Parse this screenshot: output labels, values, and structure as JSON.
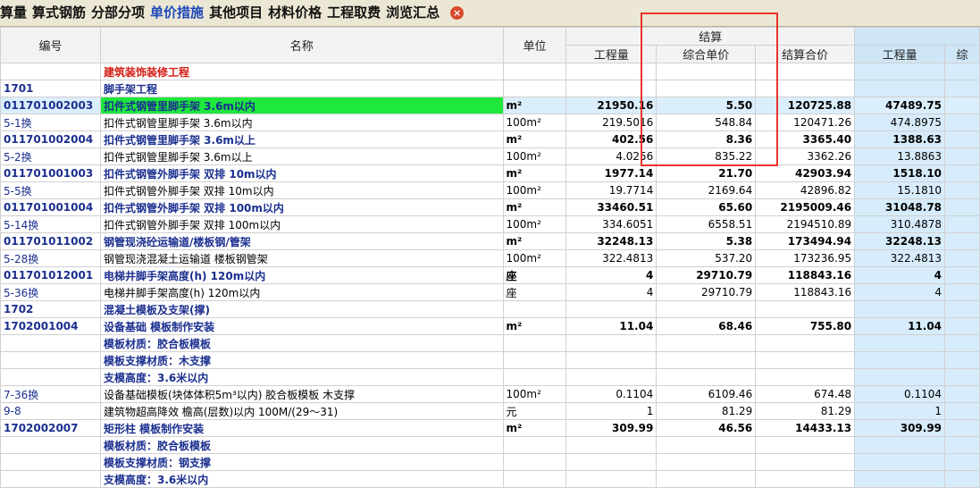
{
  "tabs": [
    {
      "label": "算量",
      "active": false
    },
    {
      "label": "算式钢筋",
      "active": false
    },
    {
      "label": "分部分项",
      "active": false
    },
    {
      "label": "单价措施",
      "active": true
    },
    {
      "label": "其他项目",
      "active": false
    },
    {
      "label": "材料价格",
      "active": false
    },
    {
      "label": "工程取费",
      "active": false
    },
    {
      "label": "浏览汇总",
      "active": false
    }
  ],
  "headers": {
    "code": "编号",
    "name": "名称",
    "unit": "单位",
    "group": "结算",
    "qty": "工程量",
    "unit_price": "综合单价",
    "total": "结算合价",
    "qty2": "工程量",
    "extra": "综"
  },
  "rows": [
    {
      "type": "cat1",
      "code": "",
      "name": "建筑装饰装修工程",
      "unit": "",
      "qty": "",
      "price": "",
      "total": "",
      "qty2": ""
    },
    {
      "type": "cat",
      "code": "1701",
      "name": "脚手架工程",
      "unit": "",
      "qty": "",
      "price": "",
      "total": "",
      "qty2": ""
    },
    {
      "type": "bold sel",
      "code": "011701002003",
      "name": "扣件式钢管里脚手架 3.6m以内",
      "unit": "m²",
      "qty": "21950.16",
      "price": "5.50",
      "total": "120725.88",
      "qty2": "47489.75"
    },
    {
      "type": "sub",
      "code": "5-1换",
      "name": "扣件式钢管里脚手架 3.6m以内",
      "unit": "100m²",
      "qty": "219.5016",
      "price": "548.84",
      "total": "120471.26",
      "qty2": "474.8975"
    },
    {
      "type": "bold",
      "code": "011701002004",
      "name": "扣件式钢管里脚手架 3.6m以上",
      "unit": "m²",
      "qty": "402.56",
      "price": "8.36",
      "total": "3365.40",
      "qty2": "1388.63"
    },
    {
      "type": "sub",
      "code": "5-2换",
      "name": "扣件式钢管里脚手架 3.6m以上",
      "unit": "100m²",
      "qty": "4.0256",
      "price": "835.22",
      "total": "3362.26",
      "qty2": "13.8863"
    },
    {
      "type": "bold",
      "code": "011701001003",
      "name": "扣件式钢管外脚手架 双排 10m以内",
      "unit": "m²",
      "qty": "1977.14",
      "price": "21.70",
      "total": "42903.94",
      "qty2": "1518.10"
    },
    {
      "type": "sub",
      "code": "5-5换",
      "name": "扣件式钢管外脚手架 双排 10m以内",
      "unit": "100m²",
      "qty": "19.7714",
      "price": "2169.64",
      "total": "42896.82",
      "qty2": "15.1810"
    },
    {
      "type": "bold",
      "code": "011701001004",
      "name": "扣件式钢管外脚手架 双排 100m以内",
      "unit": "m²",
      "qty": "33460.51",
      "price": "65.60",
      "total": "2195009.46",
      "qty2": "31048.78"
    },
    {
      "type": "sub",
      "code": "5-14换",
      "name": "扣件式钢管外脚手架 双排 100m以内",
      "unit": "100m²",
      "qty": "334.6051",
      "price": "6558.51",
      "total": "2194510.89",
      "qty2": "310.4878"
    },
    {
      "type": "bold",
      "code": "011701011002",
      "name": "钢管现浇砼运输道/楼板钢/管架",
      "unit": "m²",
      "qty": "32248.13",
      "price": "5.38",
      "total": "173494.94",
      "qty2": "32248.13"
    },
    {
      "type": "sub",
      "code": "5-28换",
      "name": "钢管现浇混凝土运输道 楼板钢管架",
      "unit": "100m²",
      "qty": "322.4813",
      "price": "537.20",
      "total": "173236.95",
      "qty2": "322.4813"
    },
    {
      "type": "bold",
      "code": "011701012001",
      "name": "电梯井脚手架高度(h) 120m以内",
      "unit": "座",
      "qty": "4",
      "price": "29710.79",
      "total": "118843.16",
      "qty2": "4"
    },
    {
      "type": "sub",
      "code": "5-36换",
      "name": "电梯井脚手架高度(h) 120m以内",
      "unit": "座",
      "qty": "4",
      "price": "29710.79",
      "total": "118843.16",
      "qty2": "4"
    },
    {
      "type": "cat",
      "code": "1702",
      "name": "混凝土模板及支架(撑)",
      "unit": "",
      "qty": "",
      "price": "",
      "total": "",
      "qty2": ""
    },
    {
      "type": "bold",
      "code": "1702001004",
      "name": "设备基础 模板制作安装",
      "unit": "m²",
      "qty": "11.04",
      "price": "68.46",
      "total": "755.80",
      "qty2": "11.04"
    },
    {
      "type": "feat",
      "code": "",
      "name": "模板材质：胶合板模板",
      "unit": "",
      "qty": "",
      "price": "",
      "total": "",
      "qty2": ""
    },
    {
      "type": "feat",
      "code": "",
      "name": "模板支撑材质：木支撑",
      "unit": "",
      "qty": "",
      "price": "",
      "total": "",
      "qty2": ""
    },
    {
      "type": "feat",
      "code": "",
      "name": "支模高度：3.6米以内",
      "unit": "",
      "qty": "",
      "price": "",
      "total": "",
      "qty2": ""
    },
    {
      "type": "sub",
      "code": "7-36换",
      "name": "设备基础模板(块体体积5m³以内) 胶合板模板 木支撑",
      "unit": "100m²",
      "qty": "0.1104",
      "price": "6109.46",
      "total": "674.48",
      "qty2": "0.1104"
    },
    {
      "type": "sub",
      "code": "9-8",
      "name": "建筑物超高降效 檐高(层数)以内 100M/(29～31)",
      "unit": "元",
      "qty": "1",
      "price": "81.29",
      "total": "81.29",
      "qty2": "1"
    },
    {
      "type": "bold",
      "code": "1702002007",
      "name": "矩形柱 模板制作安装",
      "unit": "m²",
      "qty": "309.99",
      "price": "46.56",
      "total": "14433.13",
      "qty2": "309.99"
    },
    {
      "type": "feat",
      "code": "",
      "name": "模板材质：胶合板模板",
      "unit": "",
      "qty": "",
      "price": "",
      "total": "",
      "qty2": ""
    },
    {
      "type": "feat",
      "code": "",
      "name": "模板支撑材质：钢支撑",
      "unit": "",
      "qty": "",
      "price": "",
      "total": "",
      "qty2": ""
    },
    {
      "type": "feat",
      "code": "",
      "name": "支模高度：3.6米以内",
      "unit": "",
      "qty": "",
      "price": "",
      "total": "",
      "qty2": ""
    }
  ]
}
